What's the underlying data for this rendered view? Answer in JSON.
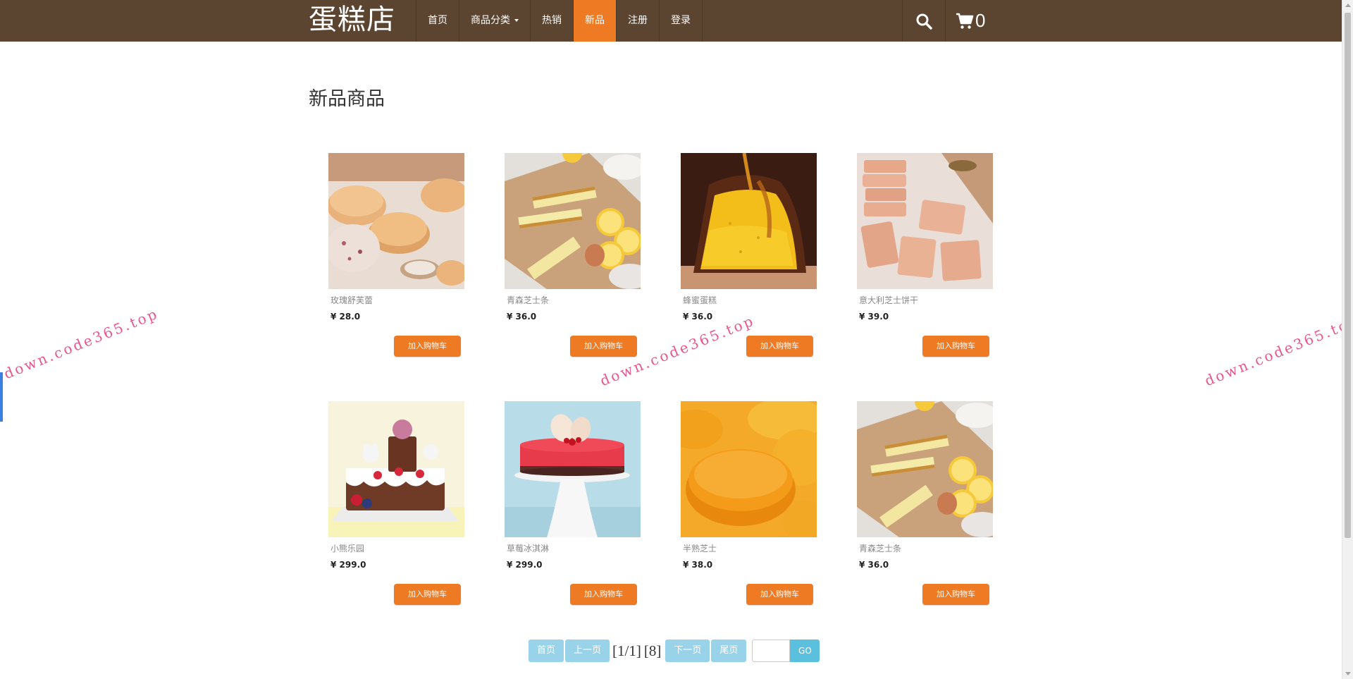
{
  "brand": "蛋糕店",
  "nav": {
    "items": [
      {
        "label": "首页"
      },
      {
        "label": "商品分类"
      },
      {
        "label": "热销"
      },
      {
        "label": "新品"
      },
      {
        "label": "注册"
      },
      {
        "label": "登录"
      }
    ],
    "active": "新品",
    "cart_count": "0",
    "color": "#5c4530",
    "active_color": "#ef7a24"
  },
  "page_title": "新品商品",
  "products": [
    {
      "name": "玫瑰舒芙蕾",
      "price": "¥ 28.0",
      "button": "加入购物车",
      "image": "macaron-buns"
    },
    {
      "name": "青森芝士条",
      "price": "¥ 36.0",
      "button": "加入购物车",
      "image": "cheese-bars-lemon"
    },
    {
      "name": "蜂蜜蛋糕",
      "price": "¥ 36.0",
      "button": "加入购物车",
      "image": "honey-cake"
    },
    {
      "name": "意大利芝士饼干",
      "price": "¥ 39.0",
      "button": "加入购物车",
      "image": "cheese-biscuits"
    },
    {
      "name": "小熊乐园",
      "price": "¥ 299.0",
      "button": "加入购物车",
      "image": "bear-cake"
    },
    {
      "name": "草莓冰淇淋",
      "price": "¥ 299.0",
      "button": "加入购物车",
      "image": "strawberry-mousse"
    },
    {
      "name": "半熟芝士",
      "price": "¥ 38.0",
      "button": "加入购物车",
      "image": "half-cooked-cheese"
    },
    {
      "name": "青森芝士条",
      "price": "¥ 36.0",
      "button": "加入购物车",
      "image": "cheese-bars-lemon"
    }
  ],
  "pagination": {
    "first": "首页",
    "prev": "上一页",
    "info": "[1/1]",
    "total": "[8]",
    "next": "下一页",
    "last": "尾页",
    "input_value": "",
    "go": "GO"
  },
  "watermark": "down.code365.top",
  "button_color": "#ef7a24"
}
